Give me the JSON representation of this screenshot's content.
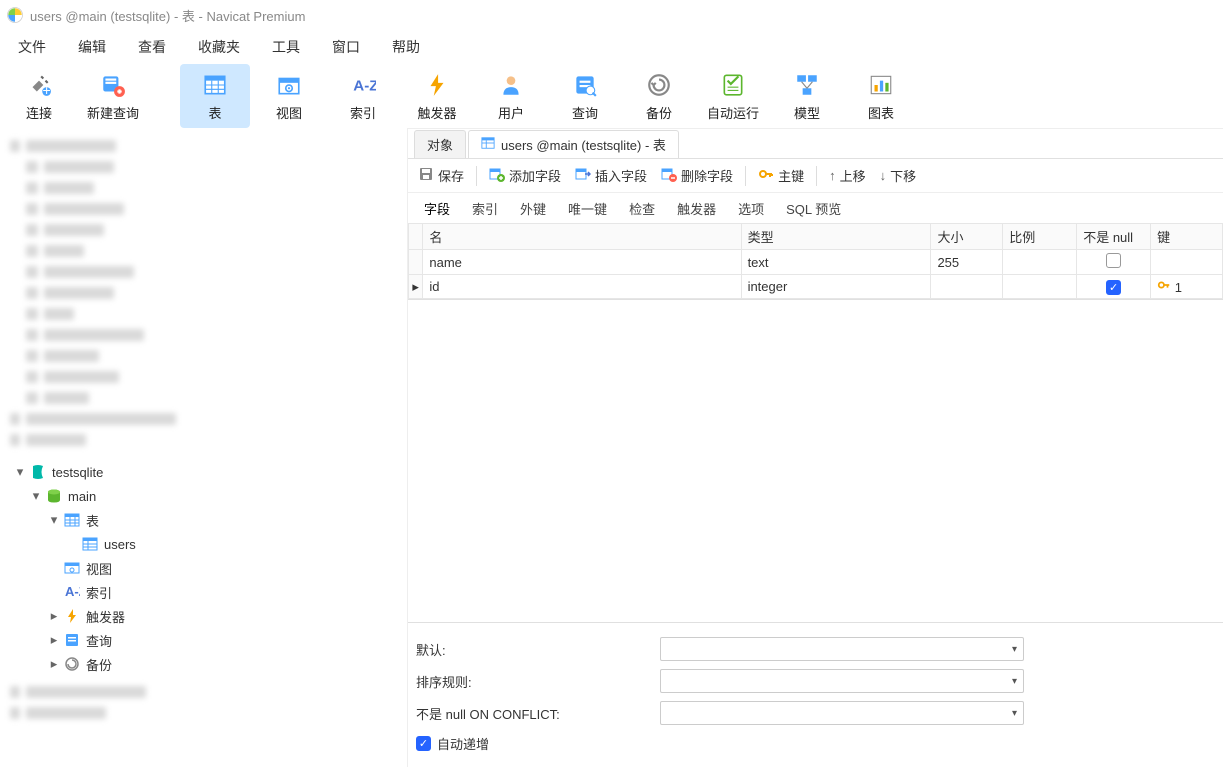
{
  "title": "users @main (testsqlite) - 表 - Navicat Premium",
  "menu": [
    "文件",
    "编辑",
    "查看",
    "收藏夹",
    "工具",
    "窗口",
    "帮助"
  ],
  "toolbar": {
    "connect": "连接",
    "newquery": "新建查询",
    "table": "表",
    "view": "视图",
    "index": "索引",
    "trigger": "触发器",
    "user": "用户",
    "query": "查询",
    "backup": "备份",
    "autorun": "自动运行",
    "model": "模型",
    "chart": "图表"
  },
  "nav": {
    "conn": "testsqlite",
    "db": "main",
    "tables": "表",
    "table_users": "users",
    "views": "视图",
    "indexes": "索引",
    "triggers": "触发器",
    "queries": "查询",
    "backups": "备份"
  },
  "tabs": {
    "objects": "对象",
    "current": "users @main (testsqlite) - 表"
  },
  "etoolbar": {
    "save": "保存",
    "addfield": "添加字段",
    "insertfield": "插入字段",
    "deletefield": "删除字段",
    "primary": "主键",
    "moveup": "上移",
    "movedown": "下移"
  },
  "ftabs": [
    "字段",
    "索引",
    "外键",
    "唯一键",
    "检查",
    "触发器",
    "选项",
    "SQL 预览"
  ],
  "grid": {
    "headers": {
      "name": "名",
      "type": "类型",
      "size": "大小",
      "scale": "比例",
      "notnull": "不是 null",
      "key": "键"
    },
    "rows": [
      {
        "name": "name",
        "type": "text",
        "size": "255",
        "scale": "",
        "notnull": false,
        "key": ""
      },
      {
        "name": "id",
        "type": "integer",
        "size": "",
        "scale": "",
        "notnull": true,
        "key": "1",
        "current": true
      }
    ]
  },
  "props": {
    "default_label": "默认:",
    "collate_label": "排序规则:",
    "notnull_conflict_label": "不是 null ON CONFLICT:",
    "autoinc_label": "自动递增",
    "autoinc": true
  }
}
